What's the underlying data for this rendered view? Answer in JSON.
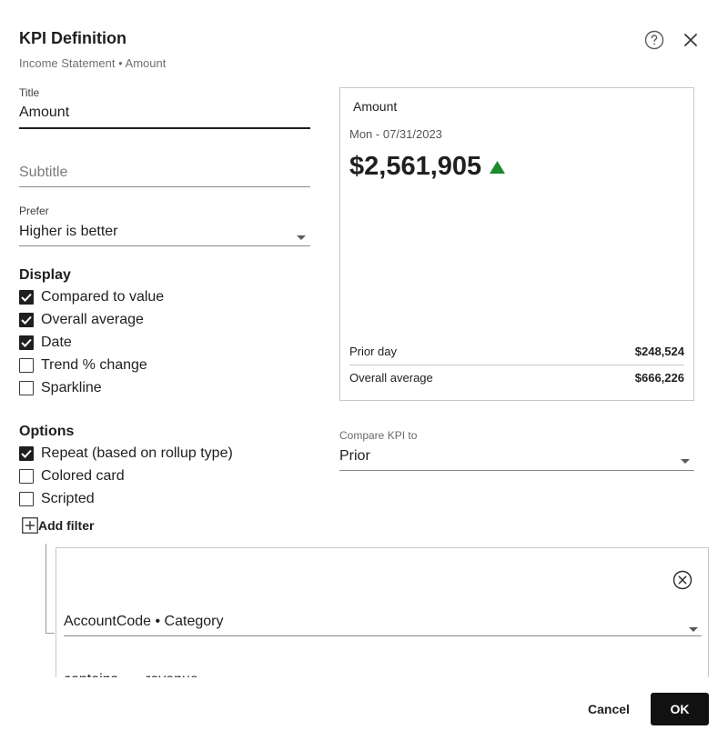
{
  "dialog": {
    "title": "KPI Definition",
    "breadcrumb": "Income Statement • Amount"
  },
  "form": {
    "title_label": "Title",
    "title_value": "Amount",
    "subtitle_placeholder": "Subtitle",
    "prefer_label": "Prefer",
    "prefer_value": "Higher is better",
    "display_head": "Display",
    "display_options": [
      {
        "label": "Compared to value",
        "checked": true
      },
      {
        "label": "Overall average",
        "checked": true
      },
      {
        "label": "Date",
        "checked": true
      },
      {
        "label": "Trend % change",
        "checked": false
      },
      {
        "label": "Sparkline",
        "checked": false
      }
    ],
    "options_head": "Options",
    "option_items": [
      {
        "label": "Repeat (based on rollup type)",
        "checked": true
      },
      {
        "label": "Colored card",
        "checked": false
      },
      {
        "label": "Scripted",
        "checked": false
      }
    ],
    "add_filter_label": "Add filter",
    "compare_label": "Compare KPI to",
    "compare_value": "Prior"
  },
  "preview": {
    "title": "Amount",
    "date": "Mon - 07/31/2023",
    "value": "$2,561,905",
    "trend": "up",
    "rows": [
      {
        "label": "Prior day",
        "amount": "$248,524"
      },
      {
        "label": "Overall average",
        "amount": "$666,226"
      }
    ]
  },
  "filter": {
    "field_value": "AccountCode • Category",
    "operator": "contains",
    "value": "revenue"
  },
  "footer": {
    "cancel_label": "Cancel",
    "ok_label": "OK"
  },
  "colors": {
    "trend_up": "#1e8a2e",
    "ok_bg": "#111111"
  }
}
